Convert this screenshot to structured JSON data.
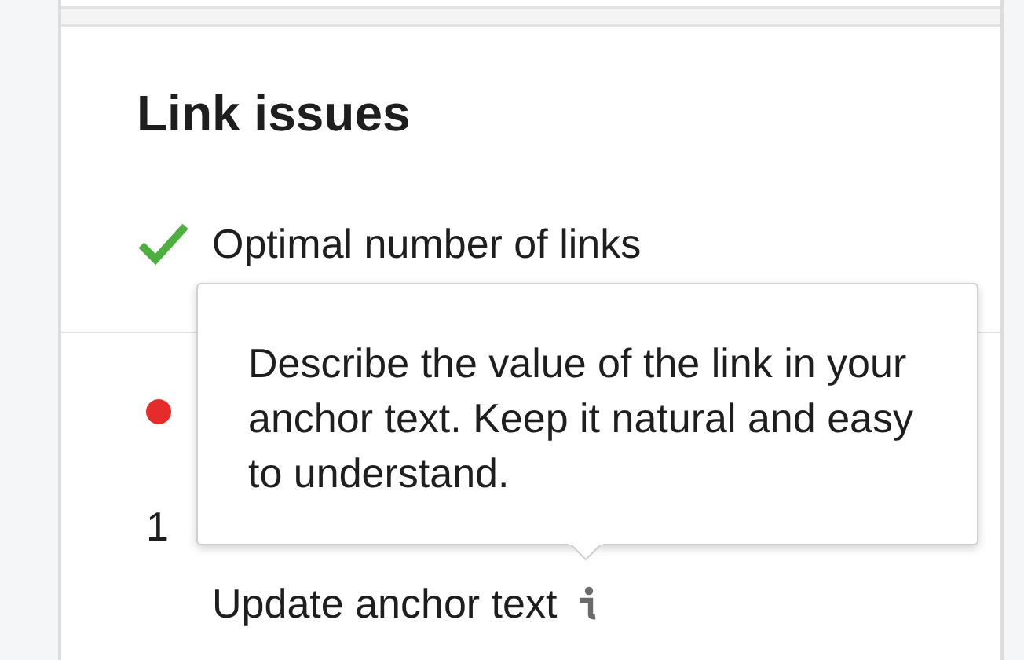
{
  "section": {
    "title": "Link issues",
    "checks": [
      {
        "kind": "pass",
        "text": "Optimal number of links"
      }
    ]
  },
  "issue": {
    "kind": "fail",
    "count": "1",
    "action": "Update anchor text"
  },
  "tooltip": {
    "text": "Describe the value of the link in your anchor text. Keep it natural and easy to understand."
  }
}
